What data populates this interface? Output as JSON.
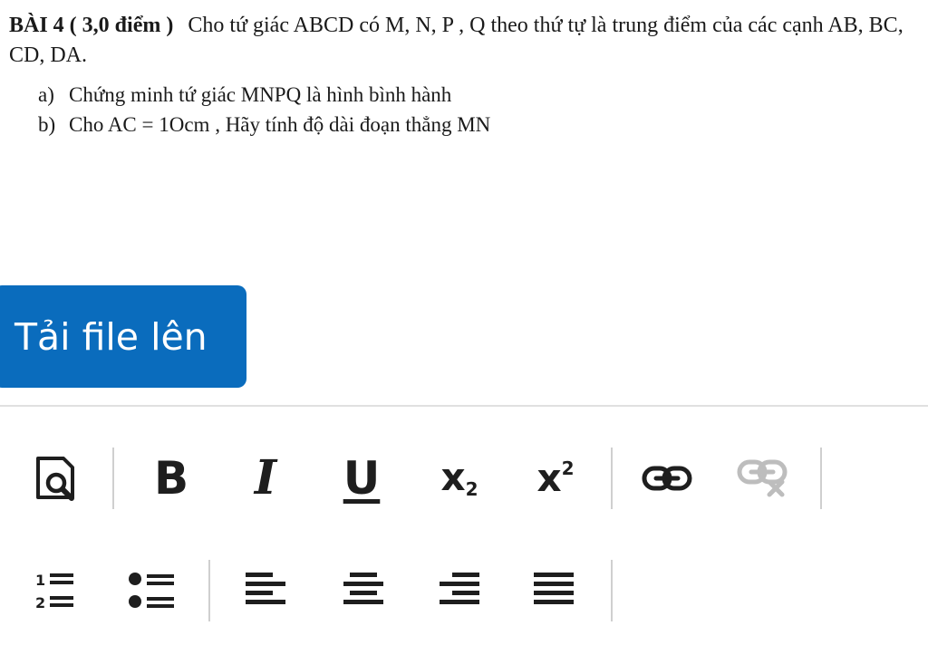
{
  "question": {
    "score": "BÀI 4 ( 3,0  điểm )",
    "text": "Cho tứ giác ABCD có M, N, P , Q theo thứ tự là trung điểm của các cạnh AB, BC, CD, DA.",
    "parts": [
      {
        "mark": "a)",
        "text": "Chứng minh tứ giác MNPQ là hình bình hành"
      },
      {
        "mark": "b)",
        "text": "Cho AC = 1Ocm , Hãy tính độ dài đoạn thẳng MN"
      }
    ]
  },
  "upload": {
    "label": "Tải file lên",
    "color": "#0a6cbd"
  },
  "toolbar": {
    "bold_glyph": "B",
    "italic_glyph": "I",
    "underline_glyph": "U",
    "subscript_base": "x",
    "subscript_sup": "2",
    "superscript_base": "x",
    "superscript_sup": "2",
    "icons": [
      "preview-icon",
      "bold-icon",
      "italic-icon",
      "underline-icon",
      "subscript-icon",
      "superscript-icon",
      "link-icon",
      "unlink-icon",
      "numbered-list-icon",
      "bullet-list-icon",
      "align-left-icon",
      "align-center-icon",
      "align-right-icon",
      "align-justify-icon"
    ]
  }
}
